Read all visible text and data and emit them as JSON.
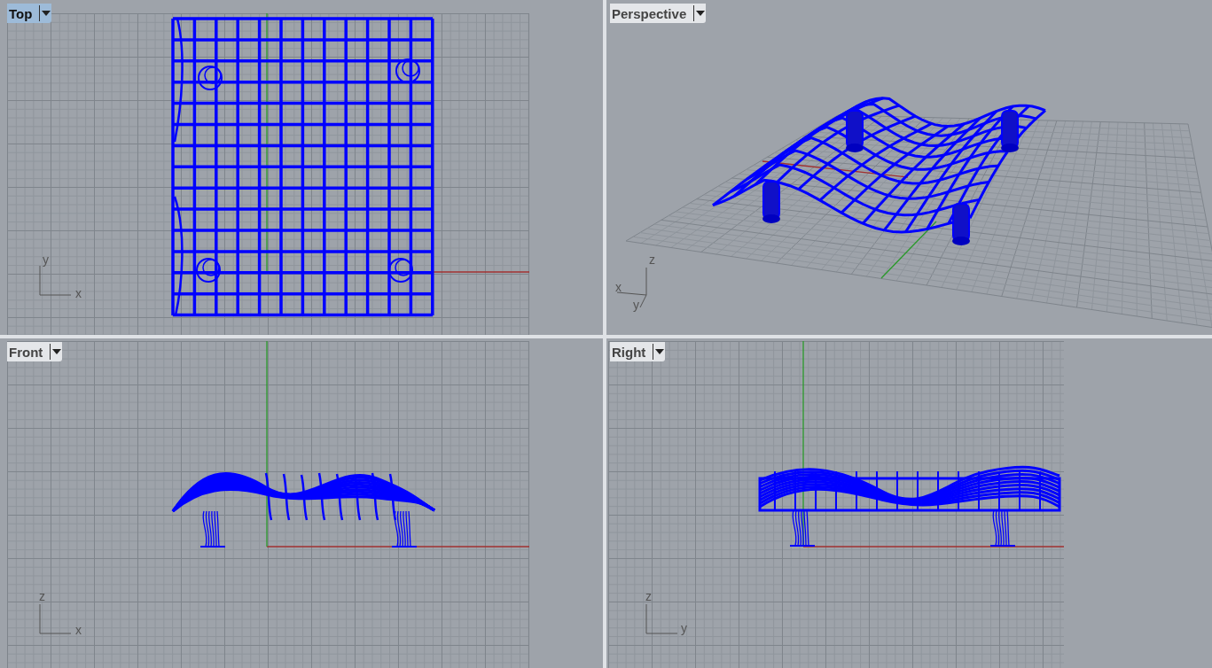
{
  "viewports": [
    {
      "title": "Top",
      "selected": true,
      "kind": "top",
      "axes": [
        "y",
        "x"
      ]
    },
    {
      "title": "Perspective",
      "selected": false,
      "kind": "perspective",
      "axes": [
        "z",
        "x",
        "y"
      ]
    },
    {
      "title": "Front",
      "selected": false,
      "kind": "front",
      "axes": [
        "z",
        "x"
      ]
    },
    {
      "title": "Right",
      "selected": false,
      "kind": "right",
      "axes": [
        "z",
        "y"
      ]
    }
  ]
}
